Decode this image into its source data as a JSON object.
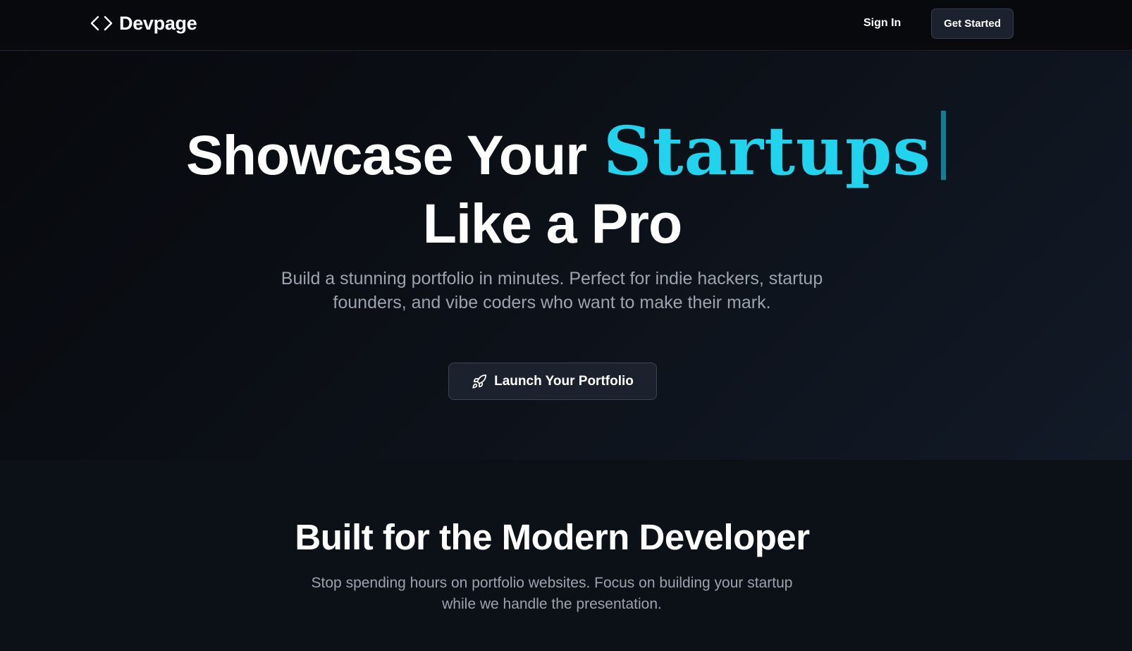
{
  "header": {
    "logo_icon": "code-brackets-icon",
    "logo_text": "Devpage",
    "sign_in_label": "Sign In",
    "get_started_label": "Get Started"
  },
  "hero": {
    "title_prefix": "Showcase Your",
    "title_highlight": "Startups",
    "title_line2": "Like a Pro",
    "subtitle": "Build a stunning portfolio in minutes. Perfect for indie hackers, startup founders, and vibe coders who want to make their mark.",
    "cta_icon": "rocket-icon",
    "cta_label": "Launch Your Portfolio"
  },
  "features": {
    "title": "Built for the Modern Developer",
    "subtitle": "Stop spending hours on portfolio websites. Focus on building your startup while we handle the presentation."
  },
  "colors": {
    "background": "#0b0e14",
    "accent": "#22d3ee",
    "cursor": "#0e7f96",
    "muted_text": "#9ca3af",
    "button_bg": "#1b222d"
  }
}
